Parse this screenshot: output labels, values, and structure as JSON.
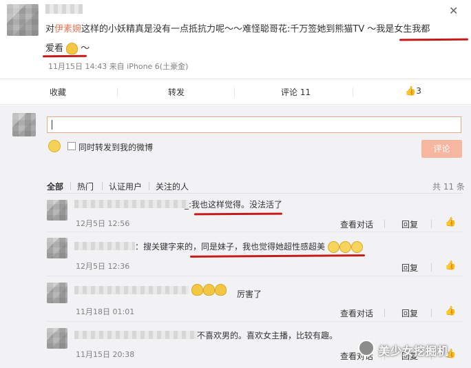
{
  "post": {
    "text_pre": "对",
    "text_name": "伊素婉",
    "text_mid": "这样的小妖精真是没有一点抵抗力呢～～难怪聪哥花:千万签她到熊猫TV ～我是女生我都",
    "text_line2": "爱看",
    "text_line2_tail": "～",
    "meta": "11月15日 14:43 来自 iPhone 6(土豪金)"
  },
  "actions": {
    "collect": "收藏",
    "forward": "转发",
    "comment": "评论 11",
    "like_count": "3"
  },
  "composer": {
    "forward_label": "同时转发到我的微博",
    "submit_label": "评论"
  },
  "filter_tabs": [
    "全部",
    "热门",
    "认证用户",
    "关注的人"
  ],
  "total": "共 11 条",
  "comments": [
    {
      "text": "_:我也这样觉得。没法活了",
      "time": "12月5日 12:56",
      "reply": "查看对话",
      "respond": "回复"
    },
    {
      "text": "：搜关键字来的，同是妹子，我也觉得她超性感超美",
      "time": "12月5日 12:36",
      "reply": "",
      "respond": "回复"
    },
    {
      "text": "厉害了",
      "time": "11月18日 01:01",
      "reply": "查看对话",
      "respond": "回复"
    },
    {
      "text": "不喜欢男的。喜欢女主播，比较有趣。",
      "time": "11月15日 20:38",
      "reply": "查看对话",
      "respond": "回复"
    }
  ],
  "watermark": "美少女挖掘机",
  "colors": {
    "accent": "#eb7350",
    "redline": "#c61a1a",
    "bg_comments": "#f2f2f5"
  }
}
